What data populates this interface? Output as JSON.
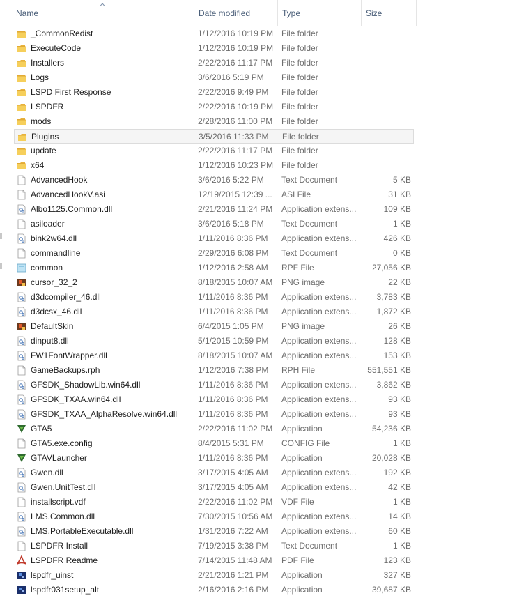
{
  "columns": {
    "name": "Name",
    "date": "Date modified",
    "type": "Type",
    "size": "Size"
  },
  "files": [
    {
      "name": "_CommonRedist",
      "date": "1/12/2016 10:19 PM",
      "type": "File folder",
      "size": "",
      "icon": "folder-icon"
    },
    {
      "name": "ExecuteCode",
      "date": "1/12/2016 10:19 PM",
      "type": "File folder",
      "size": "",
      "icon": "folder-icon"
    },
    {
      "name": "Installers",
      "date": "2/22/2016 11:17 PM",
      "type": "File folder",
      "size": "",
      "icon": "folder-icon"
    },
    {
      "name": "Logs",
      "date": "3/6/2016 5:19 PM",
      "type": "File folder",
      "size": "",
      "icon": "folder-icon"
    },
    {
      "name": "LSPD First Response",
      "date": "2/22/2016 9:49 PM",
      "type": "File folder",
      "size": "",
      "icon": "folder-icon"
    },
    {
      "name": "LSPDFR",
      "date": "2/22/2016 10:19 PM",
      "type": "File folder",
      "size": "",
      "icon": "folder-icon"
    },
    {
      "name": "mods",
      "date": "2/28/2016 11:00 PM",
      "type": "File folder",
      "size": "",
      "icon": "folder-icon"
    },
    {
      "name": "Plugins",
      "date": "3/5/2016 11:33 PM",
      "type": "File folder",
      "size": "",
      "icon": "folder-icon",
      "hover": true
    },
    {
      "name": "update",
      "date": "2/22/2016 11:17 PM",
      "type": "File folder",
      "size": "",
      "icon": "folder-icon"
    },
    {
      "name": "x64",
      "date": "1/12/2016 10:23 PM",
      "type": "File folder",
      "size": "",
      "icon": "folder-icon"
    },
    {
      "name": "AdvancedHook",
      "date": "3/6/2016 5:22 PM",
      "type": "Text Document",
      "size": "5 KB",
      "icon": "document-icon"
    },
    {
      "name": "AdvancedHookV.asi",
      "date": "12/19/2015 12:39 ...",
      "type": "ASI File",
      "size": "31 KB",
      "icon": "document-icon"
    },
    {
      "name": "Albo1125.Common.dll",
      "date": "2/21/2016 11:24 PM",
      "type": "Application extens...",
      "size": "109 KB",
      "icon": "dll-icon"
    },
    {
      "name": "asiloader",
      "date": "3/6/2016 5:18 PM",
      "type": "Text Document",
      "size": "1 KB",
      "icon": "document-icon"
    },
    {
      "name": "bink2w64.dll",
      "date": "1/11/2016 8:36 PM",
      "type": "Application extens...",
      "size": "426 KB",
      "icon": "dll-icon"
    },
    {
      "name": "commandline",
      "date": "2/29/2016 6:08 PM",
      "type": "Text Document",
      "size": "0 KB",
      "icon": "document-icon"
    },
    {
      "name": "common",
      "date": "1/12/2016 2:58 AM",
      "type": "RPF File",
      "size": "27,056 KB",
      "icon": "rpf-icon"
    },
    {
      "name": "cursor_32_2",
      "date": "8/18/2015 10:07 AM",
      "type": "PNG image",
      "size": "22 KB",
      "icon": "image-icon"
    },
    {
      "name": "d3dcompiler_46.dll",
      "date": "1/11/2016 8:36 PM",
      "type": "Application extens...",
      "size": "3,783 KB",
      "icon": "dll-icon"
    },
    {
      "name": "d3dcsx_46.dll",
      "date": "1/11/2016 8:36 PM",
      "type": "Application extens...",
      "size": "1,872 KB",
      "icon": "dll-icon"
    },
    {
      "name": "DefaultSkin",
      "date": "6/4/2015 1:05 PM",
      "type": "PNG image",
      "size": "26 KB",
      "icon": "image-icon"
    },
    {
      "name": "dinput8.dll",
      "date": "5/1/2015 10:59 PM",
      "type": "Application extens...",
      "size": "128 KB",
      "icon": "dll-icon"
    },
    {
      "name": "FW1FontWrapper.dll",
      "date": "8/18/2015 10:07 AM",
      "type": "Application extens...",
      "size": "153 KB",
      "icon": "dll-icon"
    },
    {
      "name": "GameBackups.rph",
      "date": "1/12/2016 7:38 PM",
      "type": "RPH File",
      "size": "551,551 KB",
      "icon": "document-icon"
    },
    {
      "name": "GFSDK_ShadowLib.win64.dll",
      "date": "1/11/2016 8:36 PM",
      "type": "Application extens...",
      "size": "3,862 KB",
      "icon": "dll-icon"
    },
    {
      "name": "GFSDK_TXAA.win64.dll",
      "date": "1/11/2016 8:36 PM",
      "type": "Application extens...",
      "size": "93 KB",
      "icon": "dll-icon"
    },
    {
      "name": "GFSDK_TXAA_AlphaResolve.win64.dll",
      "date": "1/11/2016 8:36 PM",
      "type": "Application extens...",
      "size": "93 KB",
      "icon": "dll-icon"
    },
    {
      "name": "GTA5",
      "date": "2/22/2016 11:02 PM",
      "type": "Application",
      "size": "54,236 KB",
      "icon": "gta-icon"
    },
    {
      "name": "GTA5.exe.config",
      "date": "8/4/2015 5:31 PM",
      "type": "CONFIG File",
      "size": "1 KB",
      "icon": "document-icon"
    },
    {
      "name": "GTAVLauncher",
      "date": "1/11/2016 8:36 PM",
      "type": "Application",
      "size": "20,028 KB",
      "icon": "gta-icon"
    },
    {
      "name": "Gwen.dll",
      "date": "3/17/2015 4:05 AM",
      "type": "Application extens...",
      "size": "192 KB",
      "icon": "dll-icon"
    },
    {
      "name": "Gwen.UnitTest.dll",
      "date": "3/17/2015 4:05 AM",
      "type": "Application extens...",
      "size": "42 KB",
      "icon": "dll-icon"
    },
    {
      "name": "installscript.vdf",
      "date": "2/22/2016 11:02 PM",
      "type": "VDF File",
      "size": "1 KB",
      "icon": "document-icon"
    },
    {
      "name": "LMS.Common.dll",
      "date": "7/30/2015 10:56 AM",
      "type": "Application extens...",
      "size": "14 KB",
      "icon": "dll-icon"
    },
    {
      "name": "LMS.PortableExecutable.dll",
      "date": "1/31/2016 7:22 AM",
      "type": "Application extens...",
      "size": "60 KB",
      "icon": "dll-icon"
    },
    {
      "name": "LSPDFR Install",
      "date": "7/19/2015 3:38 PM",
      "type": "Text Document",
      "size": "1 KB",
      "icon": "document-icon"
    },
    {
      "name": "LSPDFR Readme",
      "date": "7/14/2015 11:48 AM",
      "type": "PDF File",
      "size": "123 KB",
      "icon": "pdf-icon"
    },
    {
      "name": "lspdfr_uinst",
      "date": "2/21/2016 1:21 PM",
      "type": "Application",
      "size": "327 KB",
      "icon": "app-icon"
    },
    {
      "name": "lspdfr031setup_alt",
      "date": "2/16/2016 2:16 PM",
      "type": "Application",
      "size": "39,687 KB",
      "icon": "app-icon"
    }
  ]
}
